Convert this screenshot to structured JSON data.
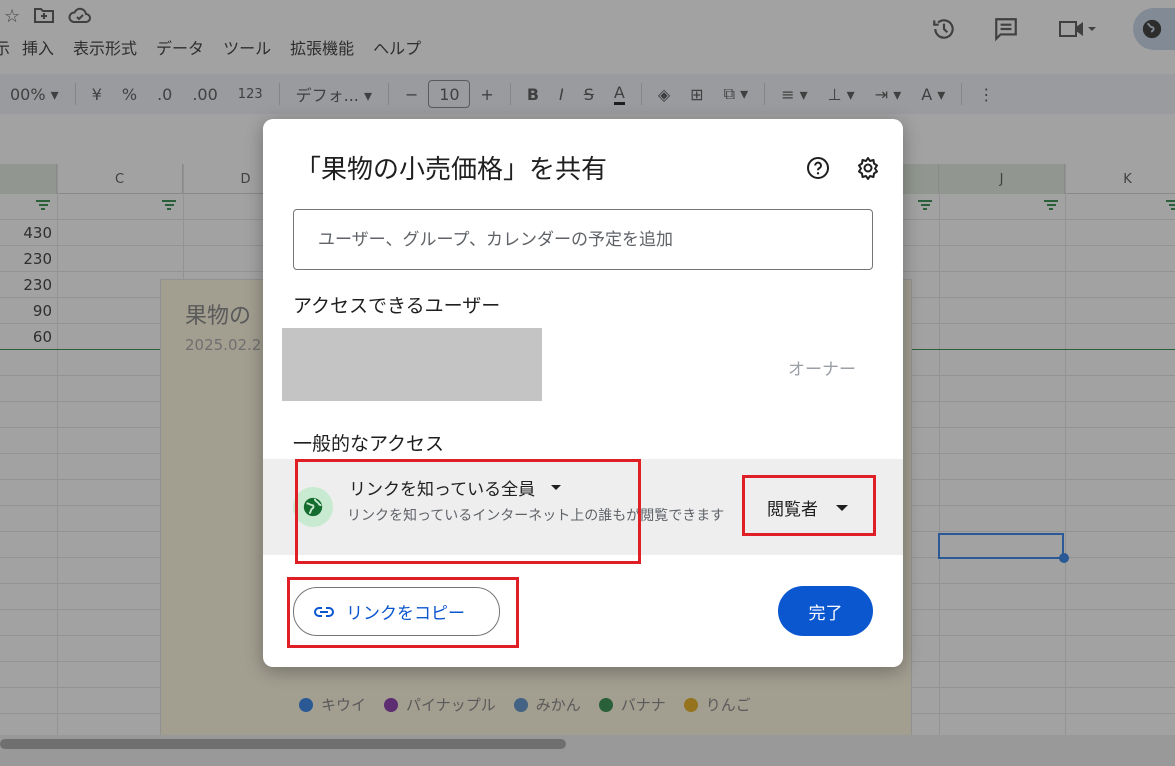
{
  "menu": {
    "items": [
      "示",
      "挿入",
      "表示形式",
      "データ",
      "ツール",
      "拡張機能",
      "ヘルプ"
    ]
  },
  "toolbar": {
    "zoom": "00%",
    "currency": "¥",
    "percent": "%",
    "dec_decrease": ".0",
    "dec_increase": ".00",
    "number_format": "123",
    "font": "デフォ...",
    "font_size": "10",
    "minus": "−",
    "plus": "+",
    "bold": "B",
    "italic": "I",
    "strike": "S",
    "textcolor": "A"
  },
  "sheet": {
    "columns": [
      "C",
      "D",
      "J",
      "K"
    ],
    "values": [
      "430",
      "230",
      "230",
      "90",
      "60"
    ]
  },
  "chart": {
    "title": "果物の",
    "subtitle": "2025.02.2",
    "legend": [
      {
        "label": "キウイ",
        "color": "#1a73e8"
      },
      {
        "label": "パイナップル",
        "color": "#7b1fa2"
      },
      {
        "label": "みかん",
        "color": "#4a86c5"
      },
      {
        "label": "バナナ",
        "color": "#188038"
      },
      {
        "label": "りんご",
        "color": "#e6a700"
      }
    ]
  },
  "dialog": {
    "title": "「果物の小売価格」を共有",
    "add_placeholder": "ユーザー、グループ、カレンダーの予定を追加",
    "access_header": "アクセスできるユーザー",
    "owner_label": "オーナー",
    "general_header": "一般的なアクセス",
    "link_scope": "リンクを知っている全員",
    "link_description": "リンクを知っているインターネット上の誰もが閲覧できます",
    "role": "閲覧者",
    "copy_link": "リンクをコピー",
    "done": "完了"
  },
  "colors": {
    "primary": "#0b57d0",
    "highlight": "#e01e26"
  }
}
